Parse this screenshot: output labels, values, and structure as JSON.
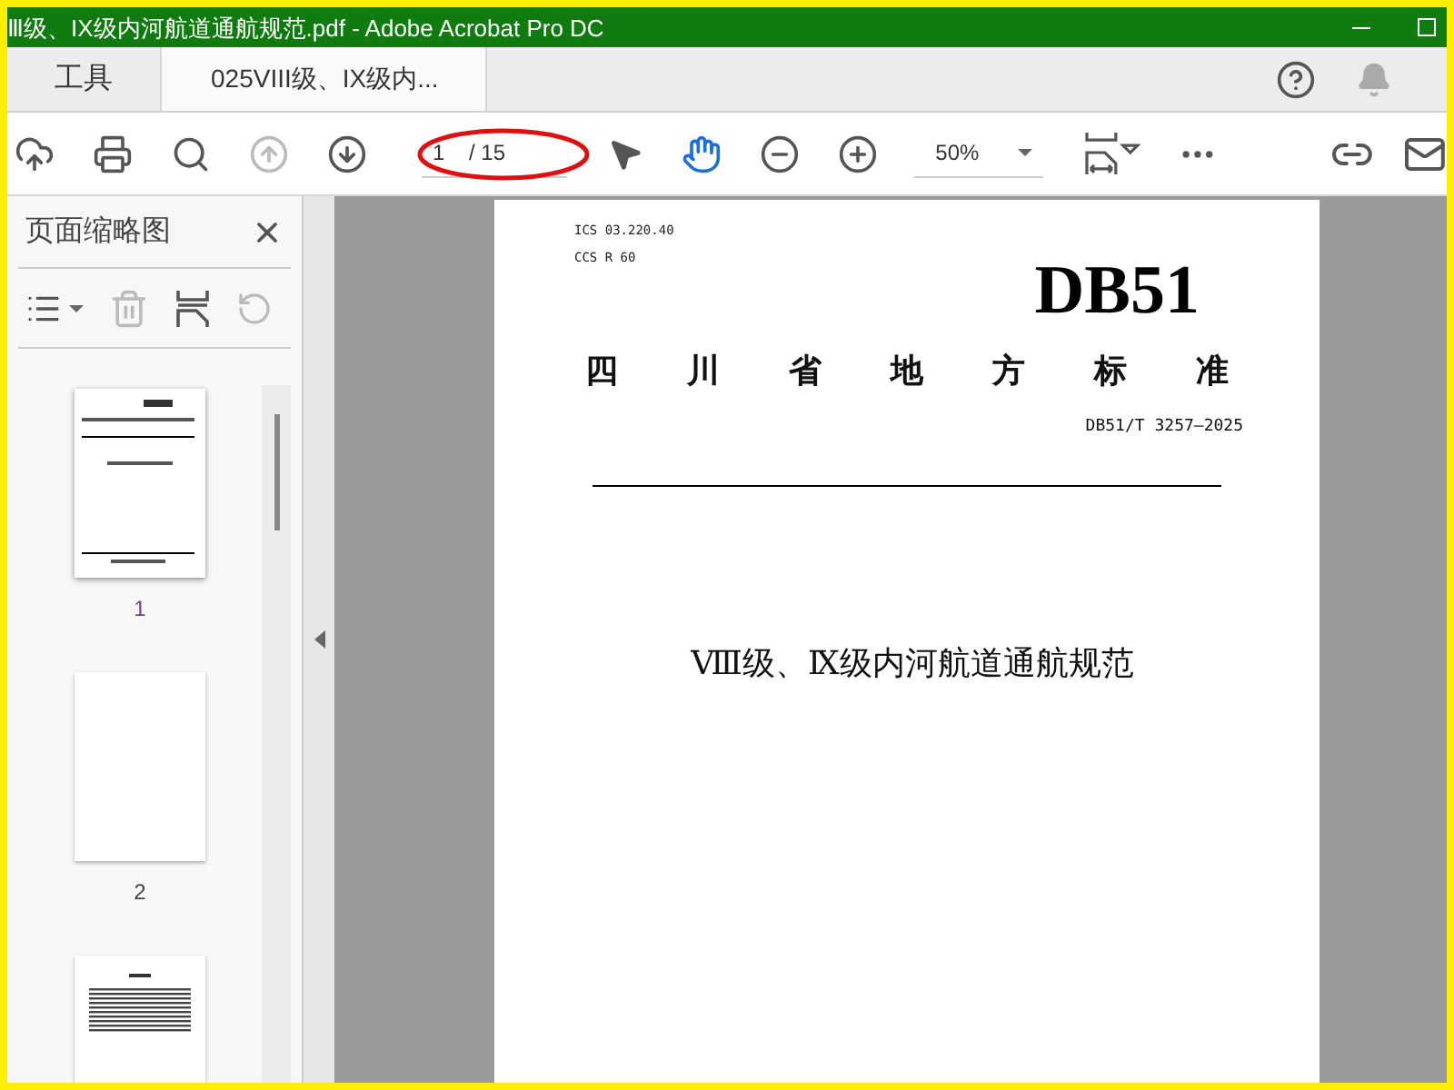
{
  "window": {
    "title": "Ⅲ级、IX级内河航道通航规范.pdf - Adobe Acrobat Pro DC"
  },
  "tabs": [
    {
      "label": "工具",
      "selected": false
    },
    {
      "label": "025VIII级、IX级内...",
      "selected": true
    }
  ],
  "toolbar": {
    "page_value": "1",
    "page_total": "/ 15",
    "zoom": "50%"
  },
  "sidebar": {
    "title": "页面缩略图",
    "thumbnails": [
      {
        "kind": "cover",
        "label": "1",
        "selected": true
      },
      {
        "kind": "blank",
        "label": "2",
        "selected": false
      },
      {
        "kind": "text",
        "selected": false
      }
    ]
  },
  "document": {
    "ics": "ICS 03.220.40",
    "ccs": "CCS R 60",
    "code": "DB51",
    "heading": [
      "四",
      "川",
      "省",
      "地",
      "方",
      "标",
      "准"
    ],
    "number": "DB51/T 3257—2025",
    "title": "Ⅷ级、Ⅸ级内河航道通航规范"
  }
}
